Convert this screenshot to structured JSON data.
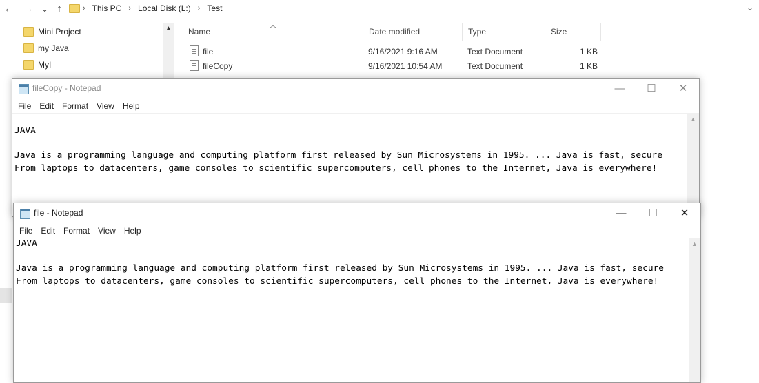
{
  "explorer": {
    "nav": {
      "back": "←",
      "forward": "→",
      "recent": "⌄",
      "up": "↑"
    },
    "breadcrumb": [
      "This PC",
      "Local Disk (L:)",
      "Test"
    ],
    "breadcrumb_sep": "›",
    "tree_items": [
      "Mini Project",
      "my Java",
      "MyI"
    ],
    "columns": [
      "Name",
      "Date modified",
      "Type",
      "Size"
    ],
    "files": [
      {
        "name": "file",
        "date": "9/16/2021 9:16 AM",
        "type": "Text Document",
        "size": "1 KB"
      },
      {
        "name": "fileCopy",
        "date": "9/16/2021 10:54 AM",
        "type": "Text Document",
        "size": "1 KB"
      }
    ]
  },
  "notepad_back": {
    "title": "fileCopy - Notepad",
    "menu": [
      "File",
      "Edit",
      "Format",
      "View",
      "Help"
    ],
    "lines": [
      "JAVA",
      "",
      "Java is a programming language and computing platform first released by Sun Microsystems in 1995. ... Java is fast, secure",
      "From laptops to datacenters, game consoles to scientific supercomputers, cell phones to the Internet, Java is everywhere!"
    ]
  },
  "notepad_front": {
    "title": "file - Notepad",
    "menu": [
      "File",
      "Edit",
      "Format",
      "View",
      "Help"
    ],
    "lines": [
      "JAVA",
      "",
      "Java is a programming language and computing platform first released by Sun Microsystems in 1995. ... Java is fast, secure",
      "From laptops to datacenters, game consoles to scientific supercomputers, cell phones to the Internet, Java is everywhere!"
    ]
  },
  "window_controls": {
    "minimize": "—",
    "maximize": "☐",
    "close": "✕"
  },
  "colors": {
    "folder": "#f4d66b",
    "scrollbar": "#f0f0f0"
  }
}
